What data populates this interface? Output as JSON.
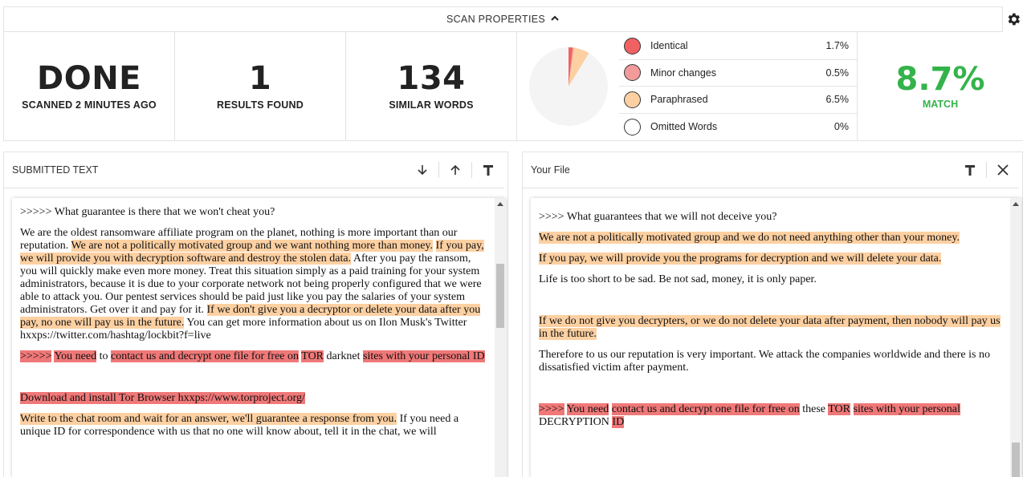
{
  "header": {
    "title": "SCAN PROPERTIES",
    "toggle_icon": "chevron-up-icon",
    "settings_icon": "gear-icon"
  },
  "stats": {
    "status": {
      "value": "DONE",
      "label": "SCANNED 2 MINUTES AGO"
    },
    "results": {
      "value": "1",
      "label": "RESULTS FOUND"
    },
    "similar": {
      "value": "134",
      "label": "SIMILAR WORDS"
    },
    "match": {
      "value": "8.7%",
      "label": "MATCH"
    }
  },
  "breakdown": {
    "items": [
      {
        "label": "Identical",
        "value": "1.7%",
        "percent": 1.7,
        "color": "#f06262"
      },
      {
        "label": "Minor changes",
        "value": "0.5%",
        "percent": 0.5,
        "color": "#f39b9b"
      },
      {
        "label": "Paraphrased",
        "value": "6.5%",
        "percent": 6.5,
        "color": "#fdd0a2"
      },
      {
        "label": "Omitted Words",
        "value": "0%",
        "percent": 0,
        "color": "#ffffff"
      }
    ],
    "pie_background": "#f4f4f4"
  },
  "colors": {
    "accent_match": "#34b34a",
    "paraphrased_highlight": "#fdd0a2",
    "identical_highlight": "#f07878"
  },
  "submitted": {
    "title": "SUBMITTED TEXT",
    "tools": [
      "arrow-down-icon",
      "arrow-up-icon",
      "text-format-icon"
    ],
    "paragraphs": [
      [
        {
          "t": ">>>>> What guarantee is there that we won't cheat you?",
          "h": ""
        }
      ],
      [
        {
          "t": "We are the oldest ransomware affiliate program on the planet, nothing is more important than our reputation. ",
          "h": ""
        },
        {
          "t": "We are not a politically motivated group and we want nothing more than money.",
          "h": "o"
        },
        {
          "t": " ",
          "h": ""
        },
        {
          "t": "If you pay, we will provide you with decryption software and destroy the stolen data.",
          "h": "o"
        },
        {
          "t": " After you pay the ransom, you will quickly make even more money. Treat this situation simply as a paid training for your system administrators, because it is due to your corporate network not being properly configured that we were able to attack you. Our pentest services should be paid just like you pay the salaries of your system administrators. Get over it and pay for it. ",
          "h": ""
        },
        {
          "t": "If we don't give you a decryptor or delete your data after you pay, no one will pay us in the future.",
          "h": "o"
        },
        {
          "t": " You can get more information about us on Ilon Musk's Twitter hxxps://twitter.com/hashtag/lockbit?f=live",
          "h": ""
        }
      ],
      [
        {
          "t": ">>>>>",
          "h": "r"
        },
        {
          "t": " ",
          "h": ""
        },
        {
          "t": "You need",
          "h": "r"
        },
        {
          "t": " to ",
          "h": ""
        },
        {
          "t": "contact us and decrypt one file for free on",
          "h": "r"
        },
        {
          "t": " ",
          "h": ""
        },
        {
          "t": "TOR",
          "h": "r"
        },
        {
          "t": " darknet ",
          "h": ""
        },
        {
          "t": "sites with your personal ID",
          "h": "r"
        }
      ],
      "spacer",
      [
        {
          "t": "Download and install Tor Browser hxxps://www.torproject.org/",
          "h": "r"
        }
      ],
      [
        {
          "t": "Write to the chat room and wait for an answer, we'll guarantee a response from you.",
          "h": "o"
        },
        {
          "t": " If you need a unique ID for correspondence with us that no one will know about, tell it in the chat, we will",
          "h": ""
        }
      ]
    ]
  },
  "yourfile": {
    "title": "Your File",
    "tools": [
      "text-format-icon",
      "close-icon"
    ],
    "paragraphs": [
      [
        {
          "t": ">>>> What guarantees that we will not deceive you?",
          "h": ""
        }
      ],
      [
        {
          "t": "We are not a politically motivated group and we do not need anything other than your money.",
          "h": "o"
        }
      ],
      [
        {
          "t": "If you pay, we will provide you the programs for decryption and we will delete your data.",
          "h": "o"
        }
      ],
      [
        {
          "t": "Life is too short to be sad. Be not sad, money, it is only paper.",
          "h": ""
        }
      ],
      "spacer",
      [
        {
          "t": "If we do not give you decrypters, or we do not delete your data after payment, then nobody will pay us in the future.",
          "h": "o"
        }
      ],
      [
        {
          "t": "Therefore to us our reputation is very important. We attack the companies worldwide and there is no dissatisfied victim after payment.",
          "h": ""
        }
      ],
      "spacer",
      [
        {
          "t": ">>>>",
          "h": "r"
        },
        {
          "t": " ",
          "h": ""
        },
        {
          "t": "You need",
          "h": "r"
        },
        {
          "t": " ",
          "h": ""
        },
        {
          "t": "contact us and decrypt one file for free on",
          "h": "r"
        },
        {
          "t": " these ",
          "h": ""
        },
        {
          "t": "TOR",
          "h": "r"
        },
        {
          "t": " ",
          "h": ""
        },
        {
          "t": "sites with your personal",
          "h": "r"
        },
        {
          "t": " DECRYPTION ",
          "h": ""
        },
        {
          "t": "ID",
          "h": "r"
        }
      ]
    ]
  }
}
